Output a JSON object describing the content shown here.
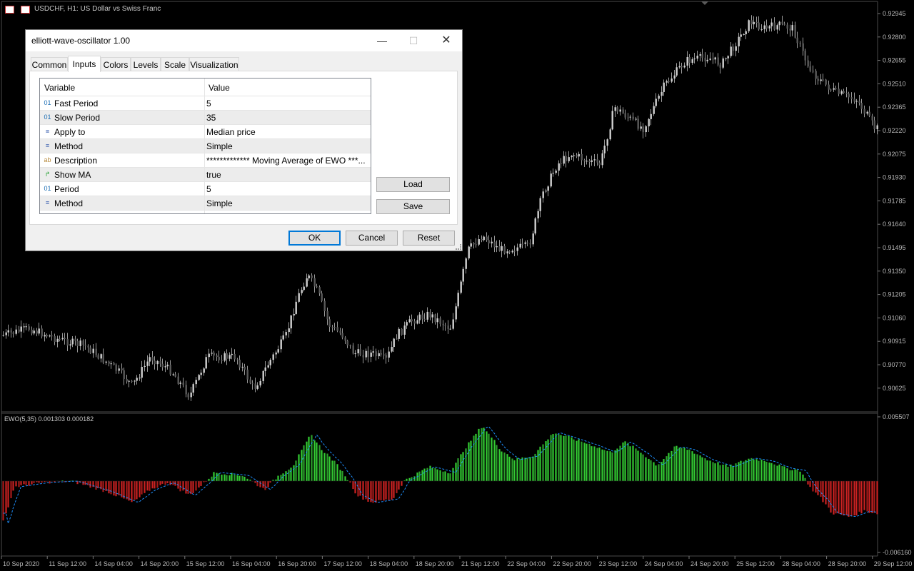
{
  "chart_header": {
    "symbol_label": "USDCHF, H1:  US Dollar vs Swiss Franc"
  },
  "indicator_label": "EWO(5,35) 0.001303 0.000182",
  "price_axis": [
    "0.92945",
    "0.92800",
    "0.92655",
    "0.92510",
    "0.92365",
    "0.92220",
    "0.92075",
    "0.91930",
    "0.91785",
    "0.91640",
    "0.91495",
    "0.91350",
    "0.91205",
    "0.91060",
    "0.90915",
    "0.90770",
    "0.90625"
  ],
  "indicator_axis": [
    "0.005507",
    "-0.006160"
  ],
  "time_axis": [
    "10 Sep 2020",
    "11 Sep 12:00",
    "14 Sep 04:00",
    "14 Sep 20:00",
    "15 Sep 12:00",
    "16 Sep 04:00",
    "16 Sep 20:00",
    "17 Sep 12:00",
    "18 Sep 04:00",
    "18 Sep 20:00",
    "21 Sep 12:00",
    "22 Sep 04:00",
    "22 Sep 20:00",
    "23 Sep 12:00",
    "24 Sep 04:00",
    "24 Sep 20:00",
    "25 Sep 12:00",
    "28 Sep 04:00",
    "28 Sep 20:00",
    "29 Sep 12:00"
  ],
  "colors": {
    "up_bar": "#33cc33",
    "down_bar": "#cc2222",
    "candle": "#c0c0c0",
    "signal": "#1e90ff",
    "accent": "#0078d7"
  },
  "dialog": {
    "title": "elliott-wave-oscillator 1.00",
    "controls": {
      "minimize": "—",
      "maximize": "☐",
      "close": "✕"
    },
    "tabs": [
      "Common",
      "Inputs",
      "Colors",
      "Levels",
      "Scale",
      "Visualization"
    ],
    "active_tab": "Inputs",
    "columns": {
      "variable": "Variable",
      "value": "Value"
    },
    "rows": [
      {
        "icon": "integer-icon",
        "glyph": "01",
        "variable": "Fast Period",
        "value": "5"
      },
      {
        "icon": "integer-icon",
        "glyph": "01",
        "variable": "Slow Period",
        "value": "35"
      },
      {
        "icon": "enum-icon",
        "glyph": "≡",
        "variable": "Apply to",
        "value": "Median price"
      },
      {
        "icon": "enum-icon",
        "glyph": "≡",
        "variable": "Method",
        "value": "Simple"
      },
      {
        "icon": "string-icon",
        "glyph": "ab",
        "variable": "Description",
        "value": "************* Moving Average of EWO ***..."
      },
      {
        "icon": "bool-icon",
        "glyph": "↱",
        "variable": "Show MA",
        "value": "true"
      },
      {
        "icon": "integer-icon",
        "glyph": "01",
        "variable": "Period",
        "value": "5"
      },
      {
        "icon": "enum-icon",
        "glyph": "≡",
        "variable": "Method",
        "value": "Simple"
      }
    ],
    "buttons": {
      "load": "Load",
      "save": "Save",
      "ok": "OK",
      "cancel": "Cancel",
      "reset": "Reset"
    }
  }
}
